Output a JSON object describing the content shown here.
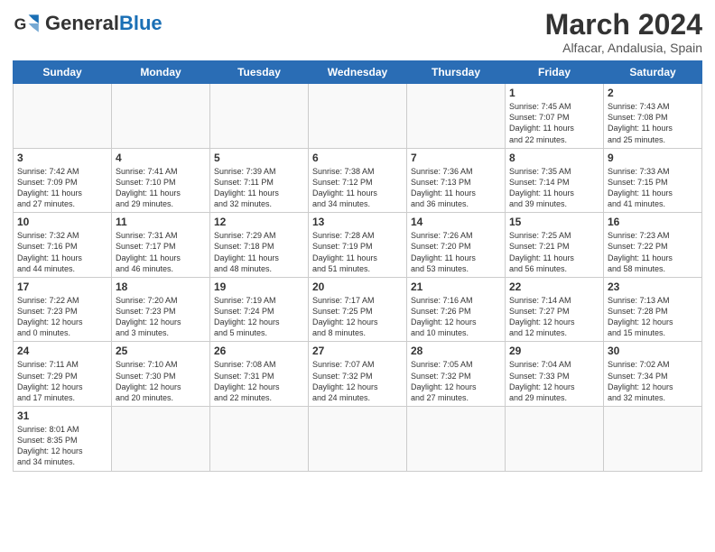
{
  "logo": {
    "text_general": "General",
    "text_blue": "Blue"
  },
  "header": {
    "month": "March 2024",
    "location": "Alfacar, Andalusia, Spain"
  },
  "weekdays": [
    "Sunday",
    "Monday",
    "Tuesday",
    "Wednesday",
    "Thursday",
    "Friday",
    "Saturday"
  ],
  "weeks": [
    [
      {
        "day": "",
        "info": ""
      },
      {
        "day": "",
        "info": ""
      },
      {
        "day": "",
        "info": ""
      },
      {
        "day": "",
        "info": ""
      },
      {
        "day": "",
        "info": ""
      },
      {
        "day": "1",
        "info": "Sunrise: 7:45 AM\nSunset: 7:07 PM\nDaylight: 11 hours\nand 22 minutes."
      },
      {
        "day": "2",
        "info": "Sunrise: 7:43 AM\nSunset: 7:08 PM\nDaylight: 11 hours\nand 25 minutes."
      }
    ],
    [
      {
        "day": "3",
        "info": "Sunrise: 7:42 AM\nSunset: 7:09 PM\nDaylight: 11 hours\nand 27 minutes."
      },
      {
        "day": "4",
        "info": "Sunrise: 7:41 AM\nSunset: 7:10 PM\nDaylight: 11 hours\nand 29 minutes."
      },
      {
        "day": "5",
        "info": "Sunrise: 7:39 AM\nSunset: 7:11 PM\nDaylight: 11 hours\nand 32 minutes."
      },
      {
        "day": "6",
        "info": "Sunrise: 7:38 AM\nSunset: 7:12 PM\nDaylight: 11 hours\nand 34 minutes."
      },
      {
        "day": "7",
        "info": "Sunrise: 7:36 AM\nSunset: 7:13 PM\nDaylight: 11 hours\nand 36 minutes."
      },
      {
        "day": "8",
        "info": "Sunrise: 7:35 AM\nSunset: 7:14 PM\nDaylight: 11 hours\nand 39 minutes."
      },
      {
        "day": "9",
        "info": "Sunrise: 7:33 AM\nSunset: 7:15 PM\nDaylight: 11 hours\nand 41 minutes."
      }
    ],
    [
      {
        "day": "10",
        "info": "Sunrise: 7:32 AM\nSunset: 7:16 PM\nDaylight: 11 hours\nand 44 minutes."
      },
      {
        "day": "11",
        "info": "Sunrise: 7:31 AM\nSunset: 7:17 PM\nDaylight: 11 hours\nand 46 minutes."
      },
      {
        "day": "12",
        "info": "Sunrise: 7:29 AM\nSunset: 7:18 PM\nDaylight: 11 hours\nand 48 minutes."
      },
      {
        "day": "13",
        "info": "Sunrise: 7:28 AM\nSunset: 7:19 PM\nDaylight: 11 hours\nand 51 minutes."
      },
      {
        "day": "14",
        "info": "Sunrise: 7:26 AM\nSunset: 7:20 PM\nDaylight: 11 hours\nand 53 minutes."
      },
      {
        "day": "15",
        "info": "Sunrise: 7:25 AM\nSunset: 7:21 PM\nDaylight: 11 hours\nand 56 minutes."
      },
      {
        "day": "16",
        "info": "Sunrise: 7:23 AM\nSunset: 7:22 PM\nDaylight: 11 hours\nand 58 minutes."
      }
    ],
    [
      {
        "day": "17",
        "info": "Sunrise: 7:22 AM\nSunset: 7:23 PM\nDaylight: 12 hours\nand 0 minutes."
      },
      {
        "day": "18",
        "info": "Sunrise: 7:20 AM\nSunset: 7:23 PM\nDaylight: 12 hours\nand 3 minutes."
      },
      {
        "day": "19",
        "info": "Sunrise: 7:19 AM\nSunset: 7:24 PM\nDaylight: 12 hours\nand 5 minutes."
      },
      {
        "day": "20",
        "info": "Sunrise: 7:17 AM\nSunset: 7:25 PM\nDaylight: 12 hours\nand 8 minutes."
      },
      {
        "day": "21",
        "info": "Sunrise: 7:16 AM\nSunset: 7:26 PM\nDaylight: 12 hours\nand 10 minutes."
      },
      {
        "day": "22",
        "info": "Sunrise: 7:14 AM\nSunset: 7:27 PM\nDaylight: 12 hours\nand 12 minutes."
      },
      {
        "day": "23",
        "info": "Sunrise: 7:13 AM\nSunset: 7:28 PM\nDaylight: 12 hours\nand 15 minutes."
      }
    ],
    [
      {
        "day": "24",
        "info": "Sunrise: 7:11 AM\nSunset: 7:29 PM\nDaylight: 12 hours\nand 17 minutes."
      },
      {
        "day": "25",
        "info": "Sunrise: 7:10 AM\nSunset: 7:30 PM\nDaylight: 12 hours\nand 20 minutes."
      },
      {
        "day": "26",
        "info": "Sunrise: 7:08 AM\nSunset: 7:31 PM\nDaylight: 12 hours\nand 22 minutes."
      },
      {
        "day": "27",
        "info": "Sunrise: 7:07 AM\nSunset: 7:32 PM\nDaylight: 12 hours\nand 24 minutes."
      },
      {
        "day": "28",
        "info": "Sunrise: 7:05 AM\nSunset: 7:32 PM\nDaylight: 12 hours\nand 27 minutes."
      },
      {
        "day": "29",
        "info": "Sunrise: 7:04 AM\nSunset: 7:33 PM\nDaylight: 12 hours\nand 29 minutes."
      },
      {
        "day": "30",
        "info": "Sunrise: 7:02 AM\nSunset: 7:34 PM\nDaylight: 12 hours\nand 32 minutes."
      }
    ],
    [
      {
        "day": "31",
        "info": "Sunrise: 8:01 AM\nSunset: 8:35 PM\nDaylight: 12 hours\nand 34 minutes."
      },
      {
        "day": "",
        "info": ""
      },
      {
        "day": "",
        "info": ""
      },
      {
        "day": "",
        "info": ""
      },
      {
        "day": "",
        "info": ""
      },
      {
        "day": "",
        "info": ""
      },
      {
        "day": "",
        "info": ""
      }
    ]
  ]
}
